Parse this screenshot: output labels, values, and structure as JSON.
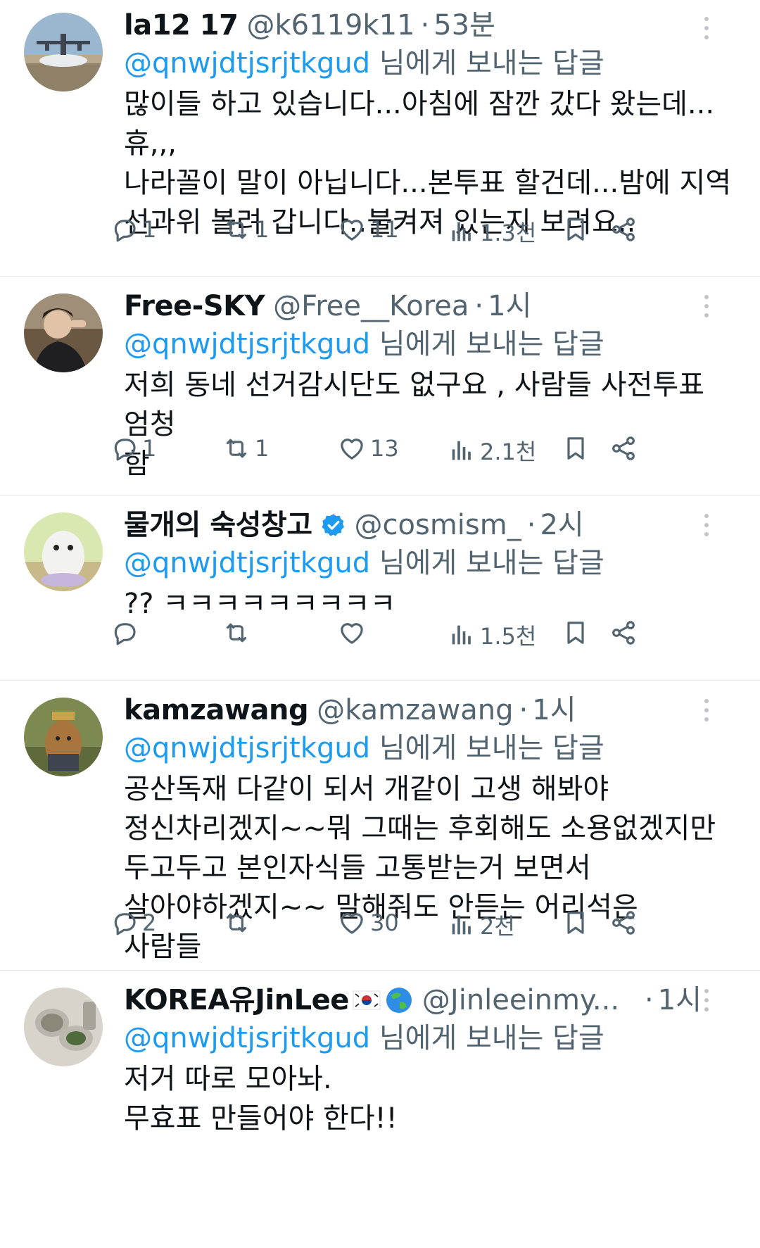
{
  "reply_label_suffix": "님에게 보내는 답글",
  "tweets": [
    {
      "name": "la12 17",
      "handle": "@k6119k11",
      "time": "53분",
      "reply_to": "@qnwjdtjsrjtkgud",
      "text": "많이들 하고 있습니다...아침에 잠깐 갔다 왔는데...휴,,,\n나라꼴이 말이 아닙니다...본투표 할건데...밤에 지역\n선과위 볼려 갑니다..불켜져 있는지 보려요..",
      "replies": "1",
      "retweets": "1",
      "likes": "11",
      "views": "1.3천"
    },
    {
      "name": "Free-SKY",
      "handle": "@Free__Korea",
      "time": "1시",
      "reply_to": "@qnwjdtjsrjtkgud",
      "text": "저희 동네 선거감시단도 없구요 , 사람들 사전투표 엄청\n함",
      "replies": "1",
      "retweets": "1",
      "likes": "13",
      "views": "2.1천"
    },
    {
      "name": "물개의 숙성창고",
      "handle": "@cosmism_",
      "time": "2시",
      "reply_to": "@qnwjdtjsrjtkgud",
      "text": "?? ㅋㅋㅋㅋㅋㅋㅋㅋㅋ",
      "replies": "",
      "retweets": "",
      "likes": "",
      "views": "1.5천"
    },
    {
      "name": "kamzawang",
      "handle": "@kamzawang",
      "time": "1시",
      "reply_to": "@qnwjdtjsrjtkgud",
      "text": "공산독재 다같이 되서 개같이 고생 해봐야\n정신차리겠지~~뭐 그때는 후회해도 소용없겠지만\n두고두고 본인자식들 고통받는거 보면서\n살아야하겠지~~ 말해줘도 안듣는 어리석은  사람들",
      "replies": "2",
      "retweets": "",
      "likes": "30",
      "views": "2천"
    },
    {
      "name": "KOREA유JinLee",
      "handle": "@Jinleeinmy...",
      "time": "1시",
      "reply_to": "@qnwjdtjsrjtkgud",
      "text": "저거 따로 모아놔.\n무효표 만들어야 한다!!",
      "replies": "",
      "retweets": "",
      "likes": "",
      "views": ""
    }
  ]
}
